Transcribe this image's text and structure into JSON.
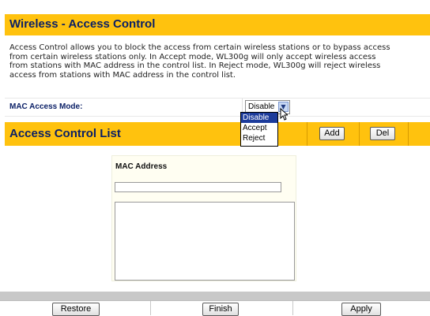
{
  "title": "Wireless - Access Control",
  "description": "Access Control allows you to block the access from certain wireless stations or to bypass access\nfrom certain wireless stations only. In Accept mode, WL300g will only accept wireless access\nfrom stations with MAC address in the control list. In Reject mode, WL300g will reject wireless\naccess from stations with MAC address in the control list.",
  "mac_access_mode": {
    "label": "MAC Access Mode:",
    "selected": "Disable",
    "options": [
      "Disable",
      "Accept",
      "Reject"
    ]
  },
  "access_control_list": {
    "title": "Access Control List",
    "add_label": "Add",
    "del_label": "Del",
    "mac_header": "MAC Address",
    "mac_input_value": ""
  },
  "footer": {
    "restore_label": "Restore",
    "finish_label": "Finish",
    "apply_label": "Apply"
  },
  "colors": {
    "header_bar": "#ffc20e",
    "title_text": "#0a1f66",
    "dropdown_highlight": "#1c3b9b"
  }
}
